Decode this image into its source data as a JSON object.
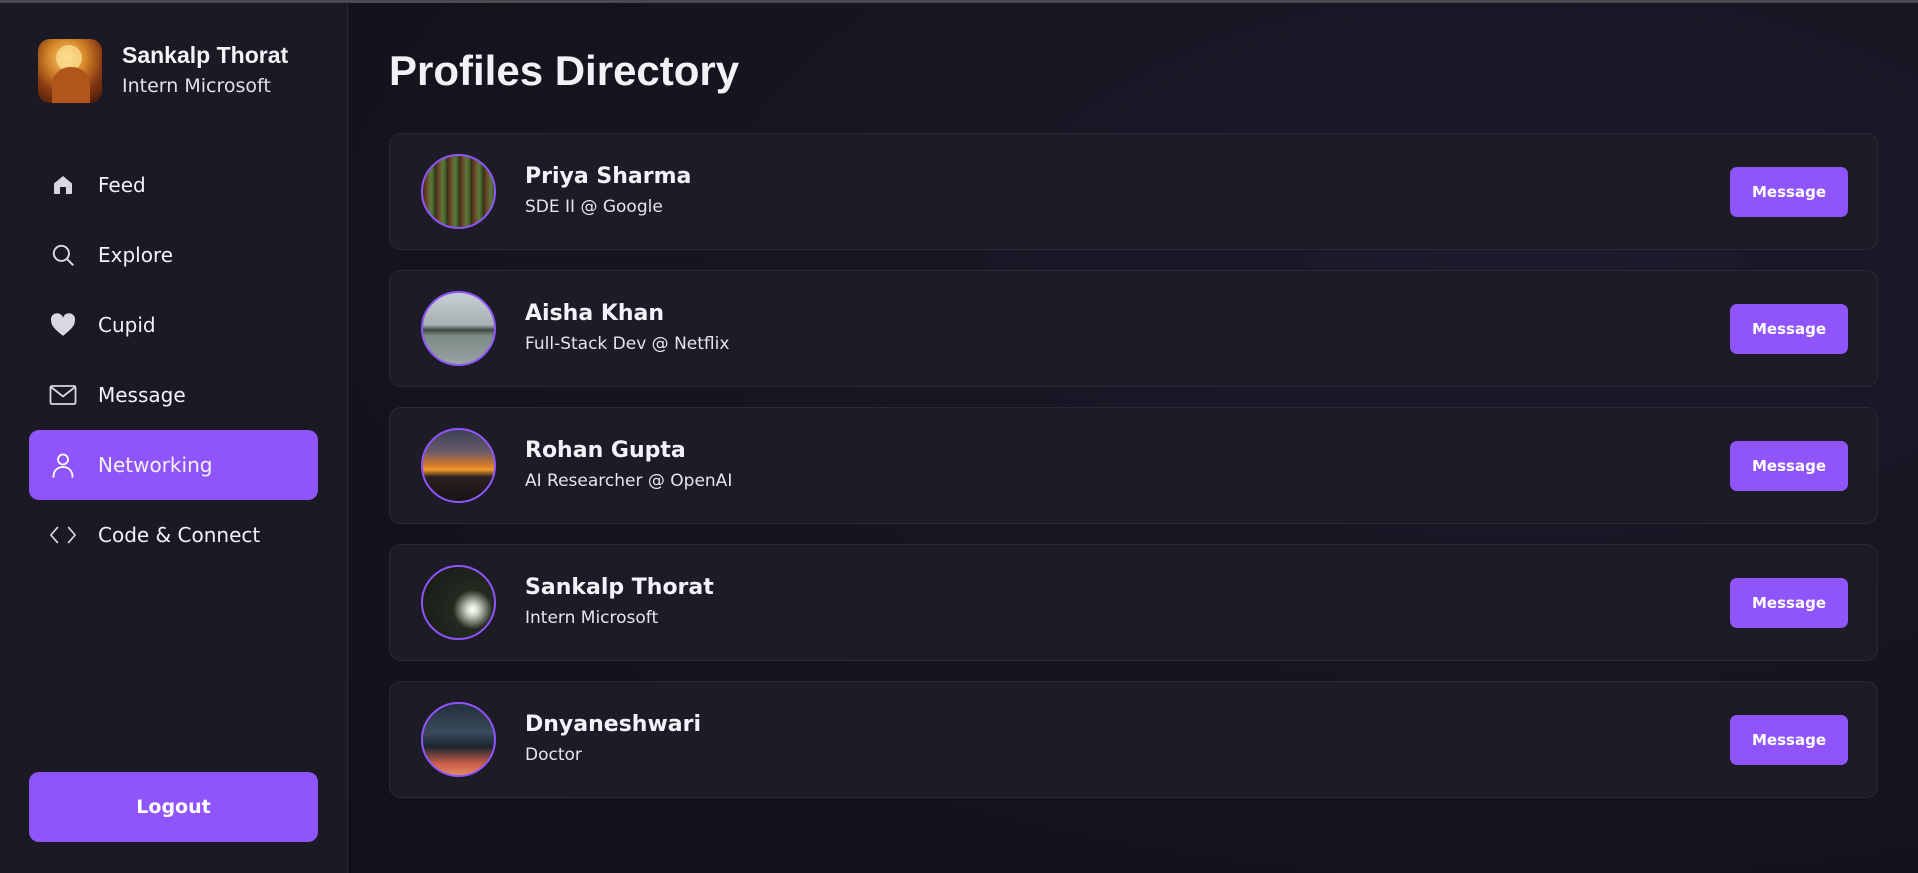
{
  "sidebar": {
    "user": {
      "name": "Sankalp Thorat",
      "role": "Intern Microsoft"
    },
    "nav": [
      {
        "label": "Feed",
        "icon": "home-icon",
        "active": false
      },
      {
        "label": "Explore",
        "icon": "search-icon",
        "active": false
      },
      {
        "label": "Cupid",
        "icon": "heart-icon",
        "active": false
      },
      {
        "label": "Message",
        "icon": "mail-icon",
        "active": false
      },
      {
        "label": "Networking",
        "icon": "user-icon",
        "active": true
      },
      {
        "label": "Code & Connect",
        "icon": "code-icon",
        "active": false
      }
    ],
    "logout_label": "Logout"
  },
  "main": {
    "title": "Profiles Directory",
    "profiles": [
      {
        "name": "Priya Sharma",
        "role": "SDE II @ Google",
        "button": "Message",
        "avatar": "forest"
      },
      {
        "name": "Aisha Khan",
        "role": "Full-Stack Dev @ Netflix",
        "button": "Message",
        "avatar": "lake"
      },
      {
        "name": "Rohan Gupta",
        "role": "AI Researcher @ OpenAI",
        "button": "Message",
        "avatar": "sunset"
      },
      {
        "name": "Sankalp Thorat",
        "role": "Intern Microsoft",
        "button": "Message",
        "avatar": "dark"
      },
      {
        "name": "Dnyaneshwari",
        "role": "Doctor",
        "button": "Message",
        "avatar": "car"
      }
    ]
  },
  "colors": {
    "accent": "#8f55fb",
    "sidebar_bg": "#1b1a24",
    "card_bg": "#1d1b26",
    "text": "#f3f2f8"
  }
}
